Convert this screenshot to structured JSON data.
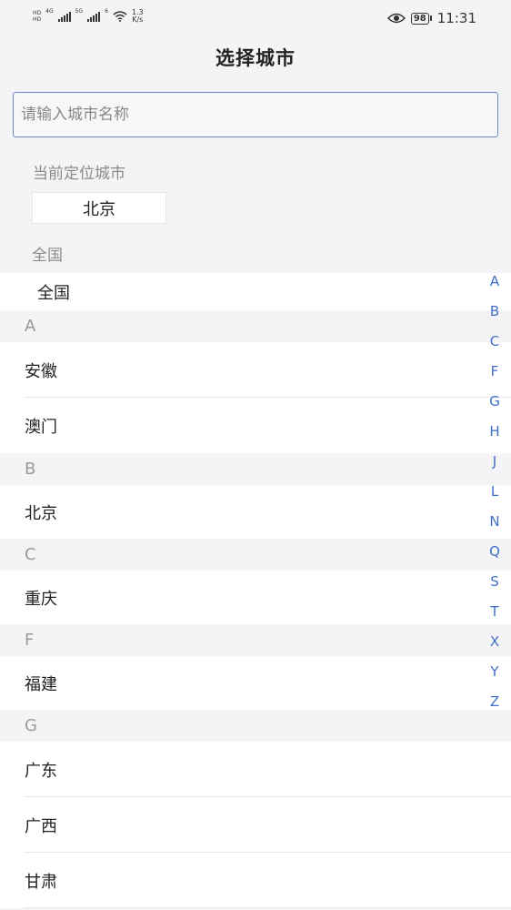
{
  "status_bar": {
    "sim1_label": "HD",
    "sim2_label": "HD",
    "net1": "4G",
    "net2": "5G",
    "wifi_tag": "6",
    "speed_value": "1.3",
    "speed_unit": "K/s",
    "battery": "98",
    "time": "11:31"
  },
  "nav": {
    "title": "选择城市"
  },
  "search": {
    "placeholder": "请输入城市名称",
    "value": ""
  },
  "current_location": {
    "label": "当前定位城市",
    "city": "北京"
  },
  "national": {
    "label": "全国",
    "item": "全国"
  },
  "groups": [
    {
      "letter": "A",
      "cities": [
        "安徽",
        "澳门"
      ]
    },
    {
      "letter": "B",
      "cities": [
        "北京"
      ]
    },
    {
      "letter": "C",
      "cities": [
        "重庆"
      ]
    },
    {
      "letter": "F",
      "cities": [
        "福建"
      ]
    },
    {
      "letter": "G",
      "cities": [
        "广东",
        "广西",
        "甘肃"
      ]
    }
  ],
  "index_letters": [
    "A",
    "B",
    "C",
    "F",
    "G",
    "H",
    "J",
    "L",
    "N",
    "Q",
    "S",
    "T",
    "X",
    "Y",
    "Z"
  ],
  "colors": {
    "accent": "#3f6fc8",
    "search_border": "#6b89c4",
    "background": "#f4f4f6"
  }
}
